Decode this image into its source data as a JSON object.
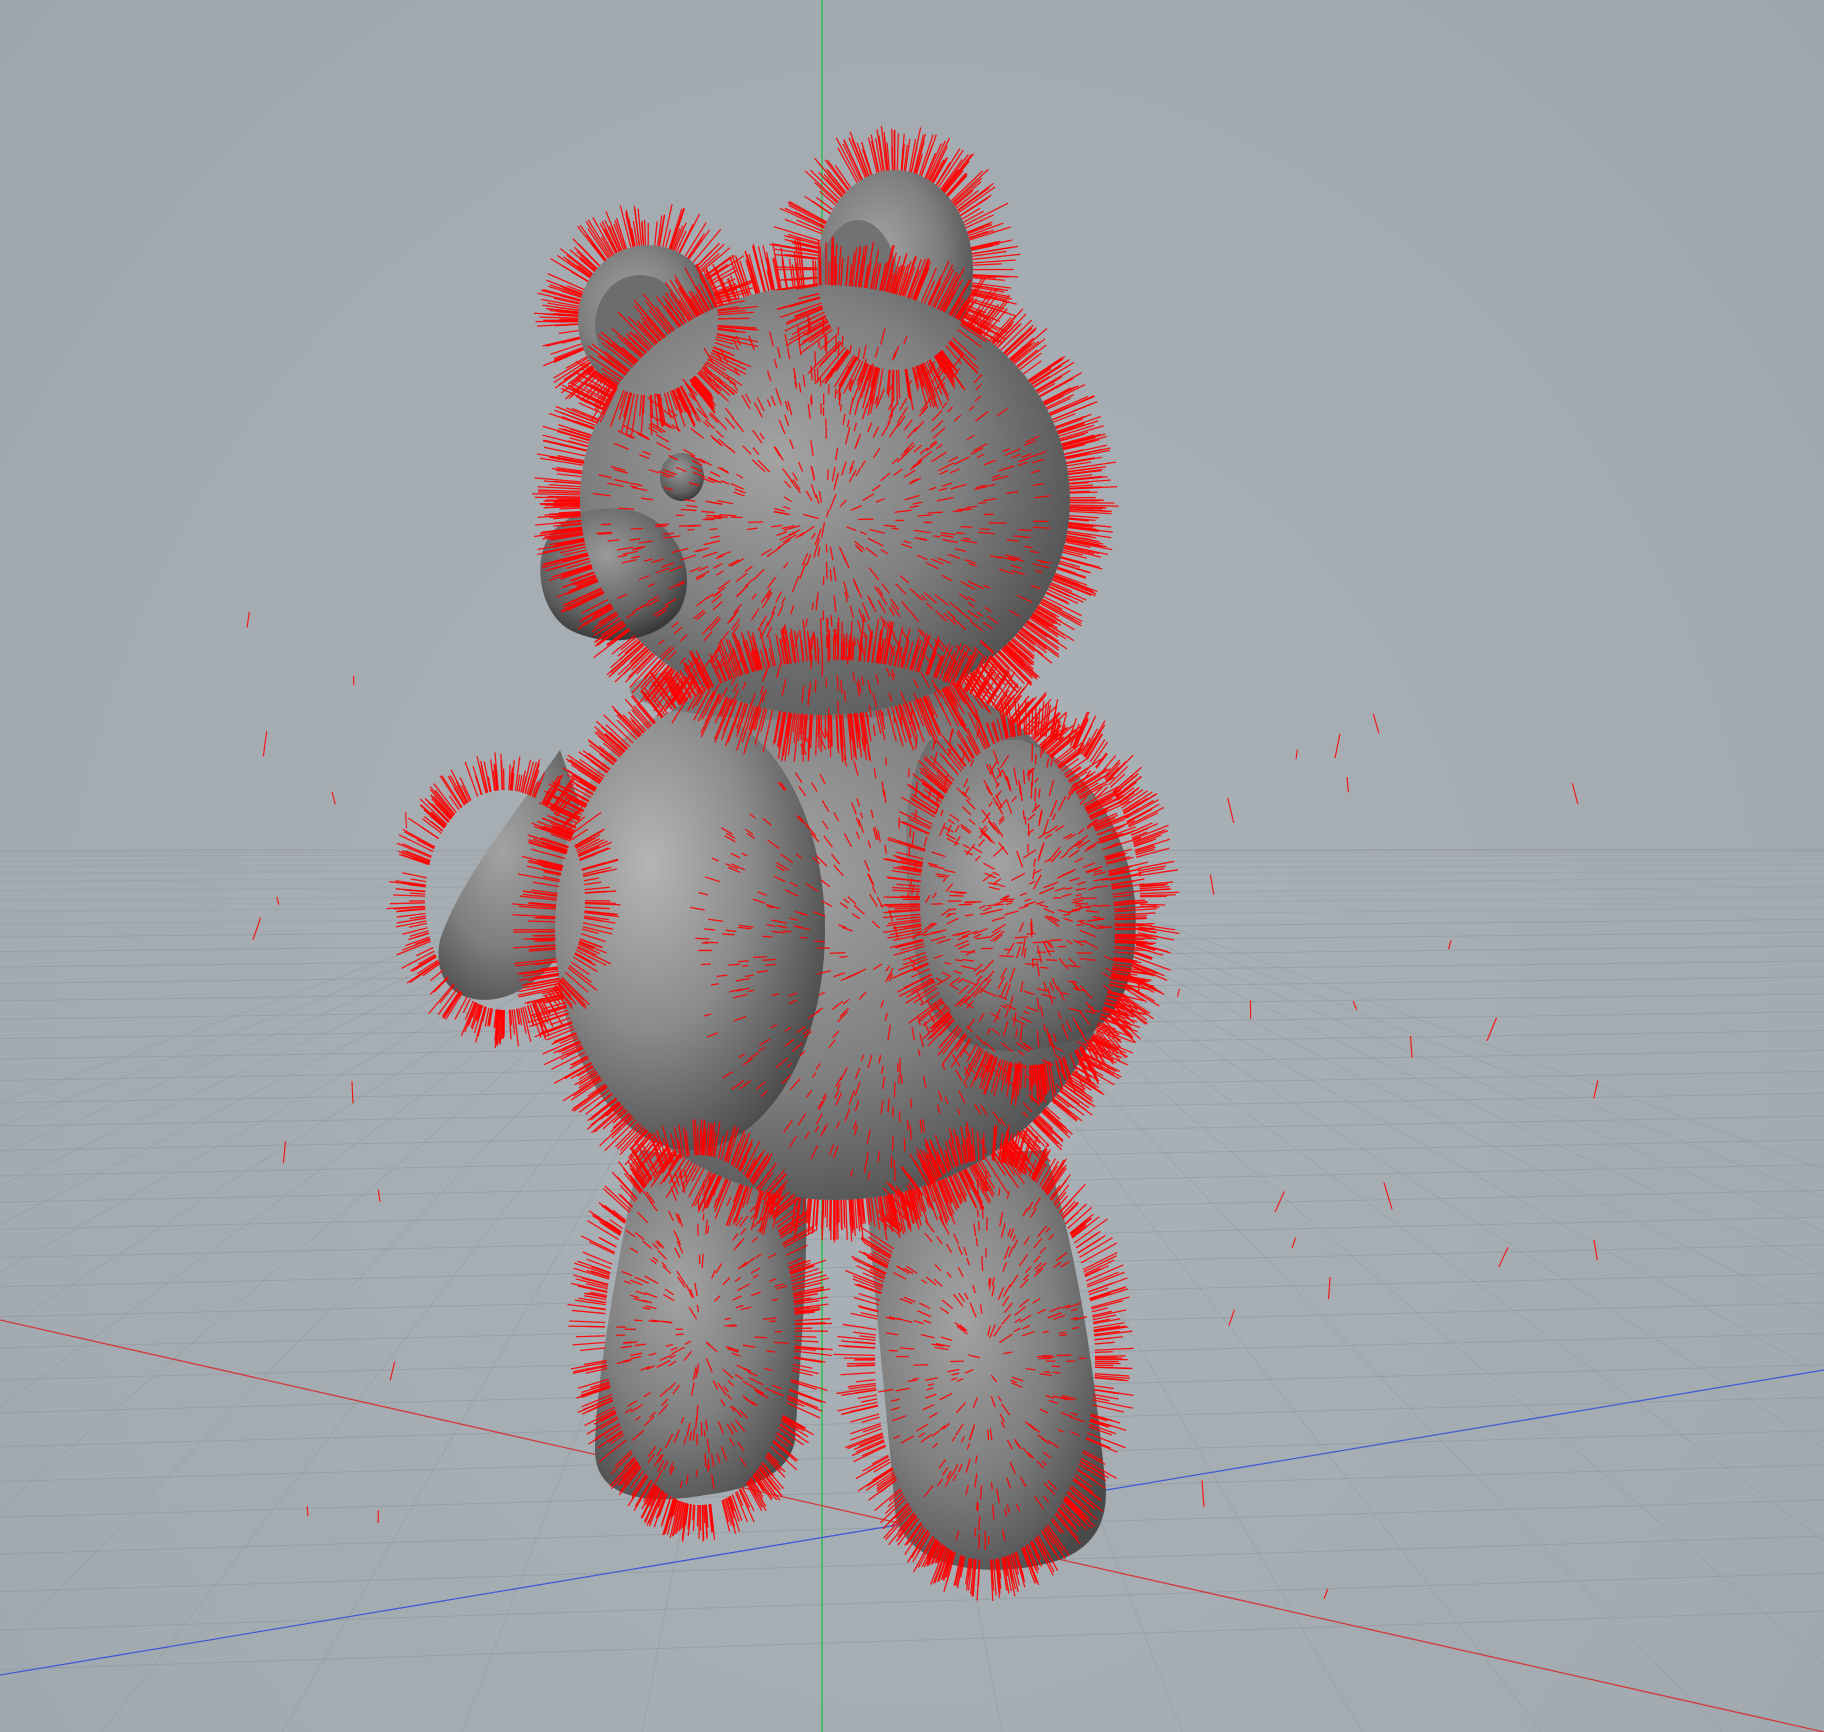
{
  "viewport": {
    "background_color": "#a7afb5",
    "grid_color": "#8e969c",
    "axis_x_color": "#d03a3a",
    "axis_y_color": "#2fbf4f",
    "axis_z_color": "#3f5bd6",
    "model_color": "#8a8a8a",
    "fur_guide_color": "#ff0000"
  },
  "model": {
    "kind": "teddy-bear",
    "overlay": "fur-guides"
  }
}
